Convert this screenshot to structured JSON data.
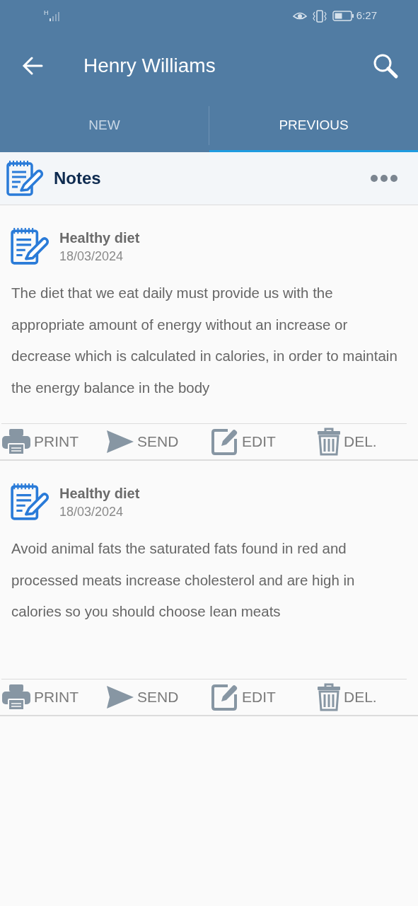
{
  "status_bar": {
    "network": "H",
    "time": "6:27"
  },
  "app_bar": {
    "title": "Henry Williams"
  },
  "tabs": [
    {
      "label": "NEW",
      "selected": false
    },
    {
      "label": "PREVIOUS",
      "selected": true
    }
  ],
  "section": {
    "title": "Notes"
  },
  "notes": [
    {
      "title": "Healthy diet",
      "date": "18/03/2024",
      "body": "The diet that we eat daily must provide us with the appropriate amount of energy without an increase or decrease which is calculated in calories, in order to maintain the energy balance in the body",
      "actions": [
        {
          "kind": "print",
          "label": "PRINT"
        },
        {
          "kind": "send",
          "label": "SEND"
        },
        {
          "kind": "edit",
          "label": "EDIT"
        },
        {
          "kind": "delete",
          "label": "DEL."
        }
      ]
    },
    {
      "title": "Healthy diet",
      "date": "18/03/2024",
      "body": "Avoid animal fats the saturated fats found in red and processed meats increase cholesterol and are high in calories so you should choose lean meats",
      "actions": [
        {
          "kind": "print",
          "label": "PRINT"
        },
        {
          "kind": "send",
          "label": "SEND"
        },
        {
          "kind": "edit",
          "label": "EDIT"
        },
        {
          "kind": "delete",
          "label": "DEL."
        }
      ]
    }
  ]
}
